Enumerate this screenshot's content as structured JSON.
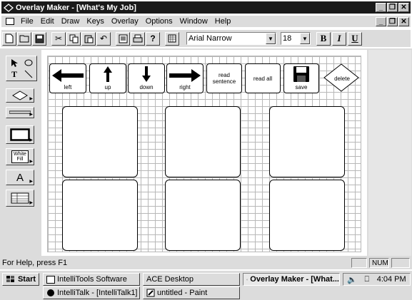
{
  "window": {
    "title": "Overlay Maker - [What's My Job]"
  },
  "menubar": {
    "items": [
      "File",
      "Edit",
      "Draw",
      "Keys",
      "Overlay",
      "Options",
      "Window",
      "Help"
    ]
  },
  "toolbar": {
    "icons": [
      "new-file-icon",
      "open-folder-icon",
      "save-icon",
      "cut-icon",
      "copy-icon",
      "paste-icon",
      "undo-icon",
      "print-preview-icon",
      "print-icon",
      "help-icon",
      "grid-icon"
    ],
    "font_value": "Arial Narrow",
    "size_value": "18",
    "bold_label": "B",
    "italic_label": "I",
    "underline_label": "U"
  },
  "tools": {
    "white_fill_label": "White\nFill",
    "text_tool_label": "A"
  },
  "overlay": {
    "keys": [
      {
        "label": "left",
        "icon": "arrow-left-icon"
      },
      {
        "label": "up",
        "icon": "arrow-up-icon"
      },
      {
        "label": "down",
        "icon": "arrow-down-icon"
      },
      {
        "label": "right",
        "icon": "arrow-right-icon"
      },
      {
        "label": "read sentence",
        "icon": null
      },
      {
        "label": "read all",
        "icon": null
      },
      {
        "label": "save",
        "icon": "floppy-disk-icon"
      },
      {
        "label": "delete",
        "icon": null
      }
    ]
  },
  "statusbar": {
    "help_text": "For Help, press F1",
    "num_indicator": "NUM"
  },
  "taskbar": {
    "start_label": "Start",
    "tasks_row1": [
      "IntelliTools Software",
      "ACE Desktop",
      "Overlay Maker - [What..."
    ],
    "tasks_row2": [
      "IntelliTalk - [IntelliTalk1]",
      "untitled - Paint"
    ],
    "clock": "4:04 PM"
  }
}
